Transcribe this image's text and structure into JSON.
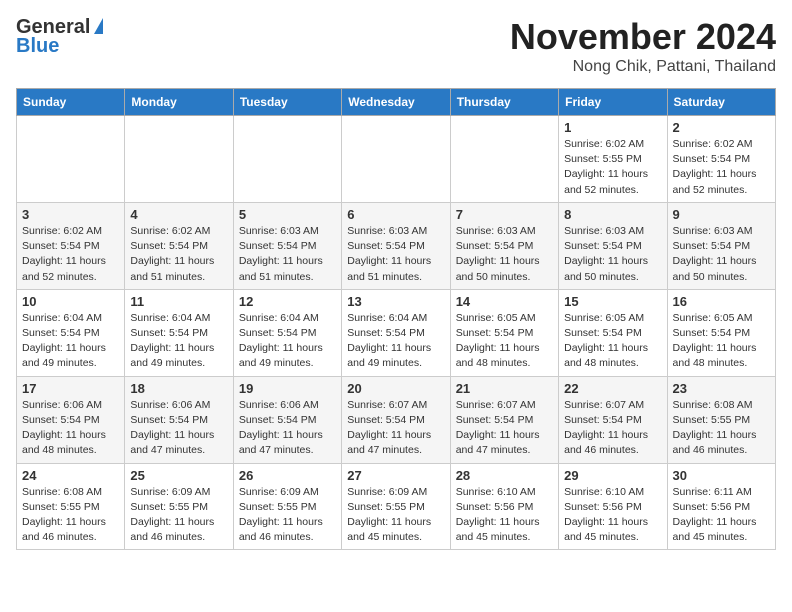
{
  "logo": {
    "line1": "General",
    "line2": "Blue"
  },
  "title": "November 2024",
  "subtitle": "Nong Chik, Pattani, Thailand",
  "weekdays": [
    "Sunday",
    "Monday",
    "Tuesday",
    "Wednesday",
    "Thursday",
    "Friday",
    "Saturday"
  ],
  "weeks": [
    [
      {
        "day": "",
        "info": ""
      },
      {
        "day": "",
        "info": ""
      },
      {
        "day": "",
        "info": ""
      },
      {
        "day": "",
        "info": ""
      },
      {
        "day": "",
        "info": ""
      },
      {
        "day": "1",
        "info": "Sunrise: 6:02 AM\nSunset: 5:55 PM\nDaylight: 11 hours\nand 52 minutes."
      },
      {
        "day": "2",
        "info": "Sunrise: 6:02 AM\nSunset: 5:54 PM\nDaylight: 11 hours\nand 52 minutes."
      }
    ],
    [
      {
        "day": "3",
        "info": "Sunrise: 6:02 AM\nSunset: 5:54 PM\nDaylight: 11 hours\nand 52 minutes."
      },
      {
        "day": "4",
        "info": "Sunrise: 6:02 AM\nSunset: 5:54 PM\nDaylight: 11 hours\nand 51 minutes."
      },
      {
        "day": "5",
        "info": "Sunrise: 6:03 AM\nSunset: 5:54 PM\nDaylight: 11 hours\nand 51 minutes."
      },
      {
        "day": "6",
        "info": "Sunrise: 6:03 AM\nSunset: 5:54 PM\nDaylight: 11 hours\nand 51 minutes."
      },
      {
        "day": "7",
        "info": "Sunrise: 6:03 AM\nSunset: 5:54 PM\nDaylight: 11 hours\nand 50 minutes."
      },
      {
        "day": "8",
        "info": "Sunrise: 6:03 AM\nSunset: 5:54 PM\nDaylight: 11 hours\nand 50 minutes."
      },
      {
        "day": "9",
        "info": "Sunrise: 6:03 AM\nSunset: 5:54 PM\nDaylight: 11 hours\nand 50 minutes."
      }
    ],
    [
      {
        "day": "10",
        "info": "Sunrise: 6:04 AM\nSunset: 5:54 PM\nDaylight: 11 hours\nand 49 minutes."
      },
      {
        "day": "11",
        "info": "Sunrise: 6:04 AM\nSunset: 5:54 PM\nDaylight: 11 hours\nand 49 minutes."
      },
      {
        "day": "12",
        "info": "Sunrise: 6:04 AM\nSunset: 5:54 PM\nDaylight: 11 hours\nand 49 minutes."
      },
      {
        "day": "13",
        "info": "Sunrise: 6:04 AM\nSunset: 5:54 PM\nDaylight: 11 hours\nand 49 minutes."
      },
      {
        "day": "14",
        "info": "Sunrise: 6:05 AM\nSunset: 5:54 PM\nDaylight: 11 hours\nand 48 minutes."
      },
      {
        "day": "15",
        "info": "Sunrise: 6:05 AM\nSunset: 5:54 PM\nDaylight: 11 hours\nand 48 minutes."
      },
      {
        "day": "16",
        "info": "Sunrise: 6:05 AM\nSunset: 5:54 PM\nDaylight: 11 hours\nand 48 minutes."
      }
    ],
    [
      {
        "day": "17",
        "info": "Sunrise: 6:06 AM\nSunset: 5:54 PM\nDaylight: 11 hours\nand 48 minutes."
      },
      {
        "day": "18",
        "info": "Sunrise: 6:06 AM\nSunset: 5:54 PM\nDaylight: 11 hours\nand 47 minutes."
      },
      {
        "day": "19",
        "info": "Sunrise: 6:06 AM\nSunset: 5:54 PM\nDaylight: 11 hours\nand 47 minutes."
      },
      {
        "day": "20",
        "info": "Sunrise: 6:07 AM\nSunset: 5:54 PM\nDaylight: 11 hours\nand 47 minutes."
      },
      {
        "day": "21",
        "info": "Sunrise: 6:07 AM\nSunset: 5:54 PM\nDaylight: 11 hours\nand 47 minutes."
      },
      {
        "day": "22",
        "info": "Sunrise: 6:07 AM\nSunset: 5:54 PM\nDaylight: 11 hours\nand 46 minutes."
      },
      {
        "day": "23",
        "info": "Sunrise: 6:08 AM\nSunset: 5:55 PM\nDaylight: 11 hours\nand 46 minutes."
      }
    ],
    [
      {
        "day": "24",
        "info": "Sunrise: 6:08 AM\nSunset: 5:55 PM\nDaylight: 11 hours\nand 46 minutes."
      },
      {
        "day": "25",
        "info": "Sunrise: 6:09 AM\nSunset: 5:55 PM\nDaylight: 11 hours\nand 46 minutes."
      },
      {
        "day": "26",
        "info": "Sunrise: 6:09 AM\nSunset: 5:55 PM\nDaylight: 11 hours\nand 46 minutes."
      },
      {
        "day": "27",
        "info": "Sunrise: 6:09 AM\nSunset: 5:55 PM\nDaylight: 11 hours\nand 45 minutes."
      },
      {
        "day": "28",
        "info": "Sunrise: 6:10 AM\nSunset: 5:56 PM\nDaylight: 11 hours\nand 45 minutes."
      },
      {
        "day": "29",
        "info": "Sunrise: 6:10 AM\nSunset: 5:56 PM\nDaylight: 11 hours\nand 45 minutes."
      },
      {
        "day": "30",
        "info": "Sunrise: 6:11 AM\nSunset: 5:56 PM\nDaylight: 11 hours\nand 45 minutes."
      }
    ]
  ]
}
